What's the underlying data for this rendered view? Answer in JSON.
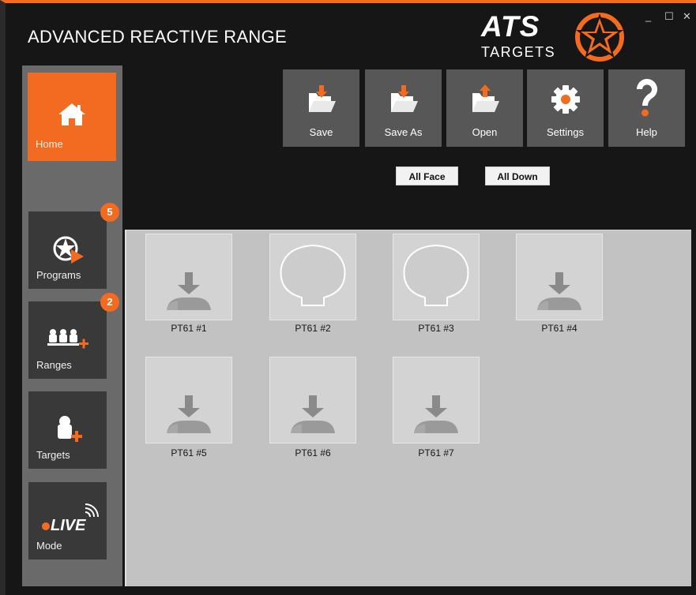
{
  "window": {
    "title": "ADVANCED REACTIVE RANGE",
    "controls": {
      "minimize": "_",
      "maximize": "☐",
      "close": "✕"
    }
  },
  "logo": {
    "main": "ATS",
    "sub": "TARGETS"
  },
  "colors": {
    "accent": "#f26b21",
    "background": "#161616",
    "sidebar": "#6a6a6a",
    "panel": "#c2c2c2"
  },
  "sidebar": {
    "items": [
      {
        "label": "Home",
        "icon": "home-icon",
        "active": true
      },
      {
        "label": "Programs",
        "icon": "programs-star-play-icon",
        "badge": "5"
      },
      {
        "label": "Ranges",
        "icon": "ranges-add-icon",
        "badge": "2"
      },
      {
        "label": "Targets",
        "icon": "targets-add-icon"
      },
      {
        "label": "Mode",
        "icon": "live-icon",
        "live_text": "LIVE"
      }
    ]
  },
  "toolbar": {
    "buttons": [
      {
        "label": "Save",
        "icon": "folder-save-icon"
      },
      {
        "label": "Save As",
        "icon": "folder-save-as-icon"
      },
      {
        "label": "Open",
        "icon": "folder-open-icon"
      },
      {
        "label": "Settings",
        "icon": "gear-icon"
      },
      {
        "label": "Help",
        "icon": "question-icon"
      }
    ]
  },
  "actions": {
    "all_face": "All Face",
    "all_down": "All Down"
  },
  "targets": [
    {
      "label": "PT61 #1",
      "state": "down"
    },
    {
      "label": "PT61 #2",
      "state": "face"
    },
    {
      "label": "PT61 #3",
      "state": "face"
    },
    {
      "label": "PT61 #4",
      "state": "down"
    },
    {
      "label": "PT61 #5",
      "state": "down"
    },
    {
      "label": "PT61 #6",
      "state": "down"
    },
    {
      "label": "PT61 #7",
      "state": "down"
    }
  ]
}
